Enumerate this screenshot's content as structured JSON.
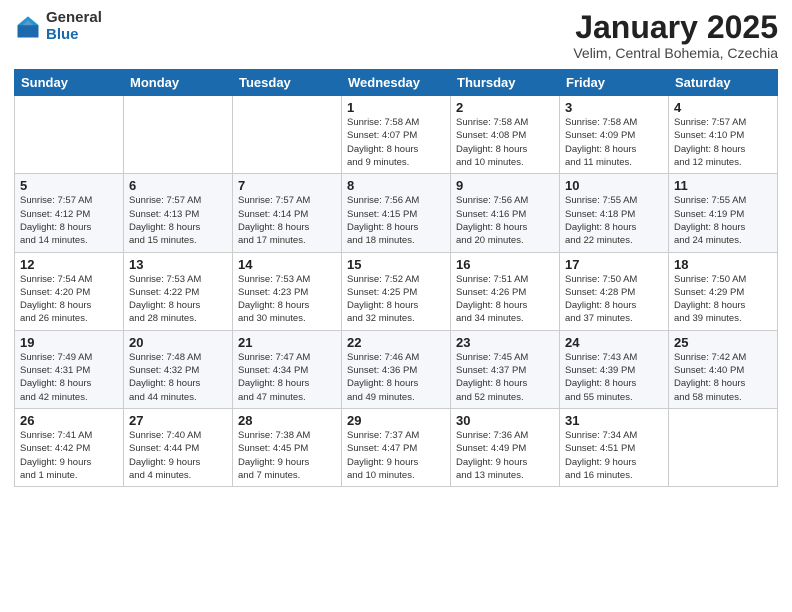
{
  "header": {
    "logo_general": "General",
    "logo_blue": "Blue",
    "month_title": "January 2025",
    "location": "Velim, Central Bohemia, Czechia"
  },
  "weekdays": [
    "Sunday",
    "Monday",
    "Tuesday",
    "Wednesday",
    "Thursday",
    "Friday",
    "Saturday"
  ],
  "weeks": [
    [
      {
        "day": "",
        "info": ""
      },
      {
        "day": "",
        "info": ""
      },
      {
        "day": "",
        "info": ""
      },
      {
        "day": "1",
        "info": "Sunrise: 7:58 AM\nSunset: 4:07 PM\nDaylight: 8 hours\nand 9 minutes."
      },
      {
        "day": "2",
        "info": "Sunrise: 7:58 AM\nSunset: 4:08 PM\nDaylight: 8 hours\nand 10 minutes."
      },
      {
        "day": "3",
        "info": "Sunrise: 7:58 AM\nSunset: 4:09 PM\nDaylight: 8 hours\nand 11 minutes."
      },
      {
        "day": "4",
        "info": "Sunrise: 7:57 AM\nSunset: 4:10 PM\nDaylight: 8 hours\nand 12 minutes."
      }
    ],
    [
      {
        "day": "5",
        "info": "Sunrise: 7:57 AM\nSunset: 4:12 PM\nDaylight: 8 hours\nand 14 minutes."
      },
      {
        "day": "6",
        "info": "Sunrise: 7:57 AM\nSunset: 4:13 PM\nDaylight: 8 hours\nand 15 minutes."
      },
      {
        "day": "7",
        "info": "Sunrise: 7:57 AM\nSunset: 4:14 PM\nDaylight: 8 hours\nand 17 minutes."
      },
      {
        "day": "8",
        "info": "Sunrise: 7:56 AM\nSunset: 4:15 PM\nDaylight: 8 hours\nand 18 minutes."
      },
      {
        "day": "9",
        "info": "Sunrise: 7:56 AM\nSunset: 4:16 PM\nDaylight: 8 hours\nand 20 minutes."
      },
      {
        "day": "10",
        "info": "Sunrise: 7:55 AM\nSunset: 4:18 PM\nDaylight: 8 hours\nand 22 minutes."
      },
      {
        "day": "11",
        "info": "Sunrise: 7:55 AM\nSunset: 4:19 PM\nDaylight: 8 hours\nand 24 minutes."
      }
    ],
    [
      {
        "day": "12",
        "info": "Sunrise: 7:54 AM\nSunset: 4:20 PM\nDaylight: 8 hours\nand 26 minutes."
      },
      {
        "day": "13",
        "info": "Sunrise: 7:53 AM\nSunset: 4:22 PM\nDaylight: 8 hours\nand 28 minutes."
      },
      {
        "day": "14",
        "info": "Sunrise: 7:53 AM\nSunset: 4:23 PM\nDaylight: 8 hours\nand 30 minutes."
      },
      {
        "day": "15",
        "info": "Sunrise: 7:52 AM\nSunset: 4:25 PM\nDaylight: 8 hours\nand 32 minutes."
      },
      {
        "day": "16",
        "info": "Sunrise: 7:51 AM\nSunset: 4:26 PM\nDaylight: 8 hours\nand 34 minutes."
      },
      {
        "day": "17",
        "info": "Sunrise: 7:50 AM\nSunset: 4:28 PM\nDaylight: 8 hours\nand 37 minutes."
      },
      {
        "day": "18",
        "info": "Sunrise: 7:50 AM\nSunset: 4:29 PM\nDaylight: 8 hours\nand 39 minutes."
      }
    ],
    [
      {
        "day": "19",
        "info": "Sunrise: 7:49 AM\nSunset: 4:31 PM\nDaylight: 8 hours\nand 42 minutes."
      },
      {
        "day": "20",
        "info": "Sunrise: 7:48 AM\nSunset: 4:32 PM\nDaylight: 8 hours\nand 44 minutes."
      },
      {
        "day": "21",
        "info": "Sunrise: 7:47 AM\nSunset: 4:34 PM\nDaylight: 8 hours\nand 47 minutes."
      },
      {
        "day": "22",
        "info": "Sunrise: 7:46 AM\nSunset: 4:36 PM\nDaylight: 8 hours\nand 49 minutes."
      },
      {
        "day": "23",
        "info": "Sunrise: 7:45 AM\nSunset: 4:37 PM\nDaylight: 8 hours\nand 52 minutes."
      },
      {
        "day": "24",
        "info": "Sunrise: 7:43 AM\nSunset: 4:39 PM\nDaylight: 8 hours\nand 55 minutes."
      },
      {
        "day": "25",
        "info": "Sunrise: 7:42 AM\nSunset: 4:40 PM\nDaylight: 8 hours\nand 58 minutes."
      }
    ],
    [
      {
        "day": "26",
        "info": "Sunrise: 7:41 AM\nSunset: 4:42 PM\nDaylight: 9 hours\nand 1 minute."
      },
      {
        "day": "27",
        "info": "Sunrise: 7:40 AM\nSunset: 4:44 PM\nDaylight: 9 hours\nand 4 minutes."
      },
      {
        "day": "28",
        "info": "Sunrise: 7:38 AM\nSunset: 4:45 PM\nDaylight: 9 hours\nand 7 minutes."
      },
      {
        "day": "29",
        "info": "Sunrise: 7:37 AM\nSunset: 4:47 PM\nDaylight: 9 hours\nand 10 minutes."
      },
      {
        "day": "30",
        "info": "Sunrise: 7:36 AM\nSunset: 4:49 PM\nDaylight: 9 hours\nand 13 minutes."
      },
      {
        "day": "31",
        "info": "Sunrise: 7:34 AM\nSunset: 4:51 PM\nDaylight: 9 hours\nand 16 minutes."
      },
      {
        "day": "",
        "info": ""
      }
    ]
  ]
}
